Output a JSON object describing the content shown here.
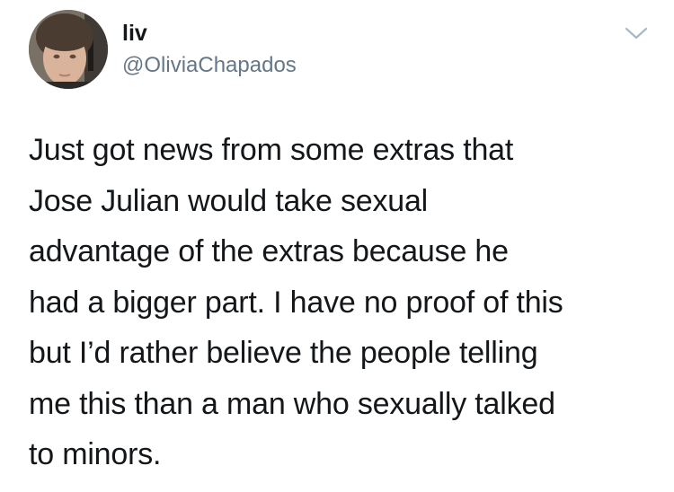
{
  "tweet": {
    "author": {
      "display_name": "liv",
      "handle": "@OliviaChapados",
      "avatar_icon": "profile-photo"
    },
    "menu_icon": "chevron-down-icon",
    "text": "Just got news from some extras that\nJose Julian would take sexual\nadvantage of the extras because he\nhad a bigger part. I have no proof of this\nbut I’d rather believe the people telling\nme this than a man who sexually talked\nto minors."
  },
  "colors": {
    "text_primary": "#14171a",
    "text_secondary": "#657786",
    "icon_gray": "#aab8c2",
    "background": "#ffffff"
  }
}
